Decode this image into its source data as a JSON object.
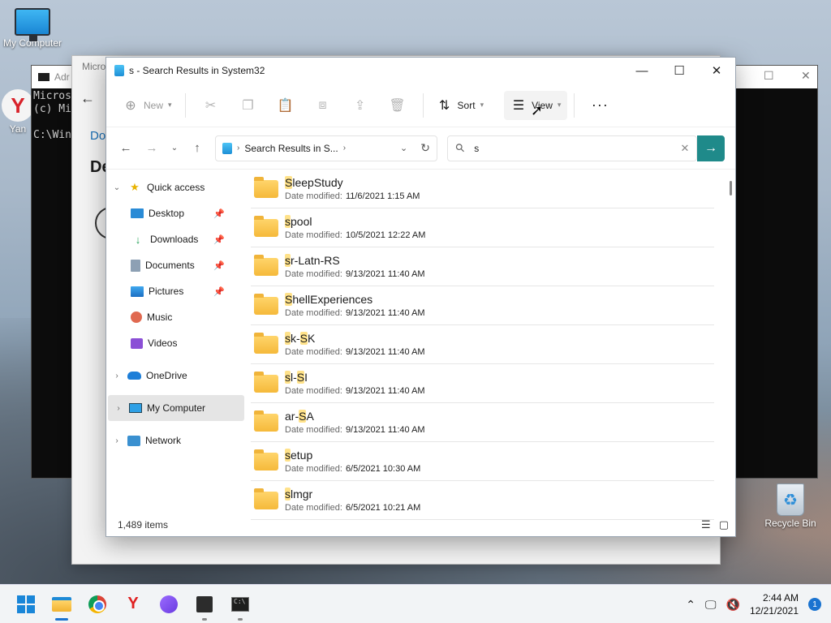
{
  "desktop": {
    "my_computer_label": "My Computer",
    "recycle_bin_label": "Recycle Bin",
    "yandex_label": "Yan"
  },
  "bg_windows": {
    "settings_title": "Micro",
    "settings_crumb": "Do",
    "settings_heading": "De",
    "cmd_title": "Adr",
    "cmd_lines": [
      "Micros",
      "(c) Mi",
      "",
      "C:\\Win"
    ]
  },
  "explorer": {
    "title": "s - Search Results in System32",
    "toolbar": {
      "new_label": "New",
      "sort_label": "Sort",
      "view_label": "View",
      "more_label": "···"
    },
    "address": {
      "path_text": "Search Results in S...",
      "search_value": "s"
    },
    "nav": {
      "quick_access": "Quick access",
      "desktop": "Desktop",
      "downloads": "Downloads",
      "documents": "Documents",
      "pictures": "Pictures",
      "music": "Music",
      "videos": "Videos",
      "onedrive": "OneDrive",
      "my_computer": "My Computer",
      "network": "Network"
    },
    "meta_label": "Date modified:",
    "files": [
      {
        "hl": "S",
        "rest": "leepStudy",
        "date": "11/6/2021 1:15 AM"
      },
      {
        "hl": "s",
        "rest": "pool",
        "date": "10/5/2021 12:22 AM"
      },
      {
        "hl": "s",
        "rest": "r-Latn-RS",
        "date": "9/13/2021 11:40 AM"
      },
      {
        "hl": "S",
        "rest": "hellExperiences",
        "date": "9/13/2021 11:40 AM"
      },
      {
        "hl": "s",
        "rest": "k-",
        "hl2": "S",
        "rest2": "K",
        "date": "9/13/2021 11:40 AM"
      },
      {
        "hl": "s",
        "rest": "l-",
        "hl2": "S",
        "rest2": "I",
        "date": "9/13/2021 11:40 AM"
      },
      {
        "pre": "ar-",
        "hl": "S",
        "rest": "A",
        "date": "9/13/2021 11:40 AM"
      },
      {
        "hl": "s",
        "rest": "etup",
        "date": "6/5/2021 10:30 AM"
      },
      {
        "hl": "s",
        "rest": "lmgr",
        "date": "6/5/2021 10:21 AM"
      }
    ],
    "status": {
      "item_count": "1,489 items"
    }
  },
  "taskbar": {
    "time": "2:44 AM",
    "date": "12/21/2021",
    "notification_count": "1"
  }
}
